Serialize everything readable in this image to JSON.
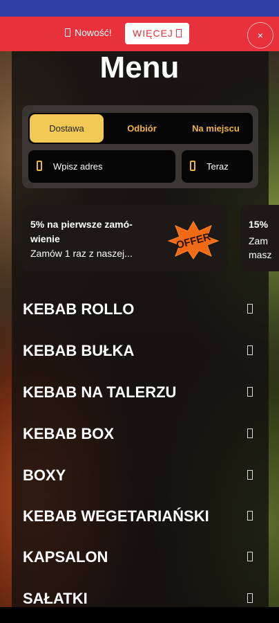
{
  "promo": {
    "text": "Nowość!",
    "more_label": "WIĘCEJ",
    "close_label": "×"
  },
  "title": "Menu",
  "order": {
    "modes": [
      "Dostawa",
      "Odbiór",
      "Na miejscu"
    ],
    "active_mode": "Dostawa",
    "address_placeholder": "Wpisz adres",
    "time_label": "Teraz"
  },
  "offers": [
    {
      "heading": "5% na pierwsze zamó-wienie",
      "subtitle": "Zamów 1 raz z naszej...",
      "badge": "OFFER"
    },
    {
      "heading": "15%",
      "subtitle": "Zam masz",
      "badge": ""
    }
  ],
  "categories": [
    "KEBAB ROLLO",
    "KEBAB BUŁKA",
    "KEBAB NA TALERZU",
    "KEBAB BOX",
    "BOXY",
    "KEBAB WEGETARIAŃSKI",
    "KAPSALON",
    "SAŁATKI"
  ],
  "colors": {
    "accent": "#f2c955",
    "promo_bar": "#e7313b",
    "status_bar": "#2e3fa3"
  }
}
